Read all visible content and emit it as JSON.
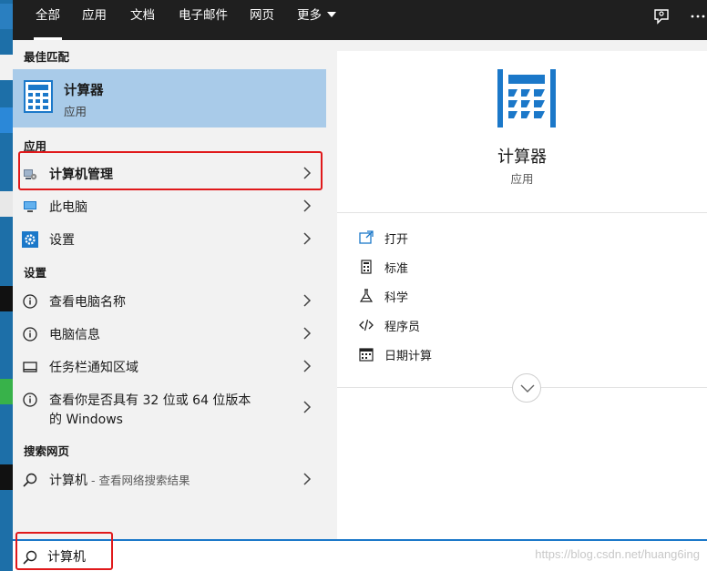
{
  "tabs": [
    "全部",
    "应用",
    "文档",
    "电子邮件",
    "网页",
    "更多"
  ],
  "top_icons": [
    "feedback-icon",
    "more-options-icon"
  ],
  "left": {
    "best_match_header": "最佳匹配",
    "best_match": {
      "name": "计算器",
      "type": "应用",
      "icon": "calculator-icon"
    },
    "apps_header": "应用",
    "apps": [
      {
        "label": "计算机管理",
        "icon": "computer-management-icon",
        "bold": true
      },
      {
        "label": "此电脑",
        "icon": "this-pc-icon"
      },
      {
        "label": "设置",
        "icon": "settings-gear-icon"
      }
    ],
    "settings_header": "设置",
    "settings": [
      {
        "label": "查看电脑名称",
        "icon": "info-icon"
      },
      {
        "label": "电脑信息",
        "icon": "info-icon"
      },
      {
        "label": "任务栏通知区域",
        "icon": "taskbar-icon"
      },
      {
        "label_line1": "查看你是否具有 32 位或 64 位版本",
        "label_line2": "的 Windows",
        "icon": "info-icon"
      }
    ],
    "web_header": "搜索网页",
    "web": {
      "label": "计算机",
      "suffix": " - 查看网络搜索结果",
      "icon": "search-icon"
    }
  },
  "right": {
    "title": "计算器",
    "subtitle": "应用",
    "actions": [
      {
        "label": "打开",
        "icon": "open-icon"
      },
      {
        "label": "标准",
        "icon": "standard-calculator-icon"
      },
      {
        "label": "科学",
        "icon": "flask-icon"
      },
      {
        "label": "程序员",
        "icon": "code-icon"
      },
      {
        "label": "日期计算",
        "icon": "calendar-icon"
      }
    ]
  },
  "search": {
    "value": "计算机",
    "placeholder": ""
  },
  "watermark": "https://blog.csdn.net/huang6ing",
  "colors": {
    "accent": "#1b78c9",
    "highlight": "#a9cbe9",
    "topbar": "#1f1f1f",
    "annotation": "#e0191b"
  }
}
